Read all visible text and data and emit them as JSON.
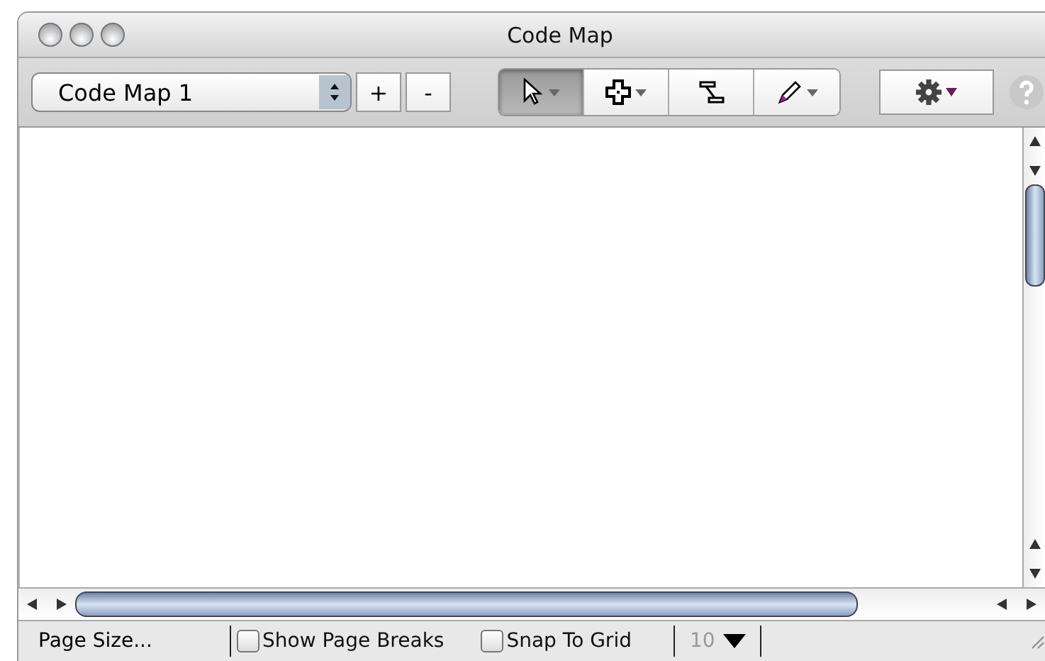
{
  "window": {
    "title": "Code Map"
  },
  "toolbar": {
    "map_selector": {
      "value": "Code Map 1"
    },
    "add_button": "+",
    "remove_button": "-",
    "tools": [
      {
        "kind": "pointer",
        "selected": true,
        "has_menu": true
      },
      {
        "kind": "shape",
        "selected": false,
        "has_menu": true
      },
      {
        "kind": "connector",
        "selected": false,
        "has_menu": false
      },
      {
        "kind": "pen",
        "selected": false,
        "has_menu": true
      }
    ]
  },
  "status_bar": {
    "page_size": "Page Size...",
    "checkboxes": [
      {
        "label": "Show Page Breaks",
        "checked": false
      },
      {
        "label": "Snap To Grid",
        "checked": false
      }
    ],
    "grid_size": {
      "value": "10",
      "disabled": true
    }
  }
}
